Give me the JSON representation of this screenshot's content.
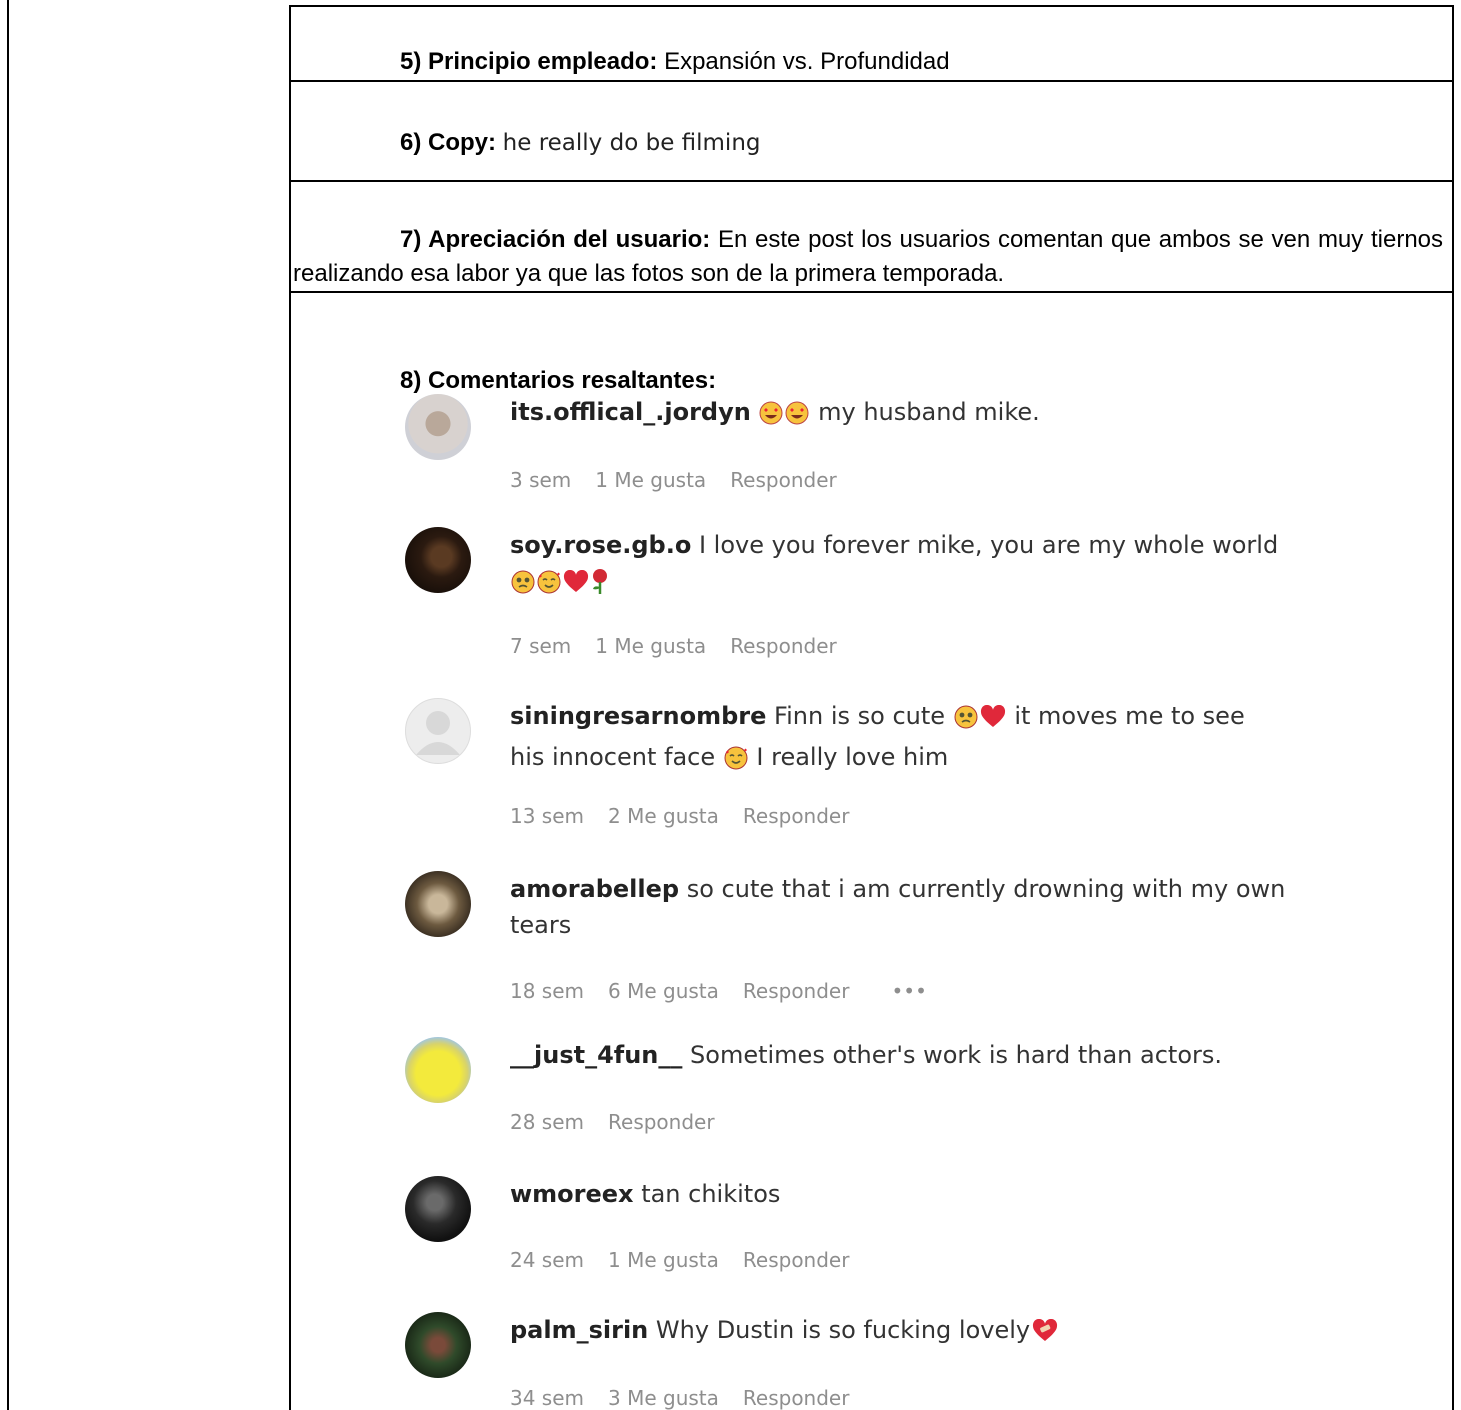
{
  "sections": {
    "principio": {
      "label": "5) Principio empleado:",
      "value": "Expansión vs. Profundidad"
    },
    "copy": {
      "label": "6) Copy:",
      "value": "he really do be filming"
    },
    "apreciacion": {
      "label": "7) Apreciación del usuario:",
      "value": "En este post los usuarios comentan que ambos se ven muy tiernos realizando esa labor ya que las fotos son de la primera temporada."
    },
    "comentarios": {
      "label": "8) Comentarios resaltantes:"
    }
  },
  "comments": [
    {
      "user": "its.offlical_.jordyn",
      "text_after": "my husband mike.",
      "emojis": [
        "heart-eyes",
        "heart-eyes"
      ],
      "time": "3 sem",
      "likes": "1 Me gusta",
      "reply": "Responder"
    },
    {
      "user": "soy.rose.gb.o",
      "text": "I love you forever mike, you are my whole world",
      "emojis": [
        "pleading",
        "smiling-hearts",
        "red-heart",
        "rose"
      ],
      "time": "7 sem",
      "likes": "1 Me gusta",
      "reply": "Responder"
    },
    {
      "user": "siningresarnombre",
      "text_a": "Finn is so cute",
      "text_b": "it moves me to see",
      "text_c": "his innocent face",
      "text_d": "I really love him",
      "time": "13 sem",
      "likes": "2 Me gusta",
      "reply": "Responder"
    },
    {
      "user": "amorabellep",
      "text": "so cute that i am currently drowning with my own",
      "text2": "tears",
      "time": "18 sem",
      "likes": "6 Me gusta",
      "reply": "Responder",
      "more": "•••"
    },
    {
      "user": "__just_4fun__",
      "text": "Sometimes other's work is hard than actors.",
      "time": "28 sem",
      "reply": "Responder"
    },
    {
      "user": "wmoreex",
      "text": "tan chikitos",
      "time": "24 sem",
      "likes": "1 Me gusta",
      "reply": "Responder"
    },
    {
      "user": "palm_sirin",
      "text": "Why Dustin is so fucking lovely",
      "emojis": [
        "heart-with-bandage"
      ],
      "time": "34 sem",
      "likes": "3 Me gusta",
      "reply": "Responder"
    }
  ],
  "colors": {
    "border": "#000000",
    "meta_text": "#8e8e8e",
    "comment_text": "#333333"
  }
}
